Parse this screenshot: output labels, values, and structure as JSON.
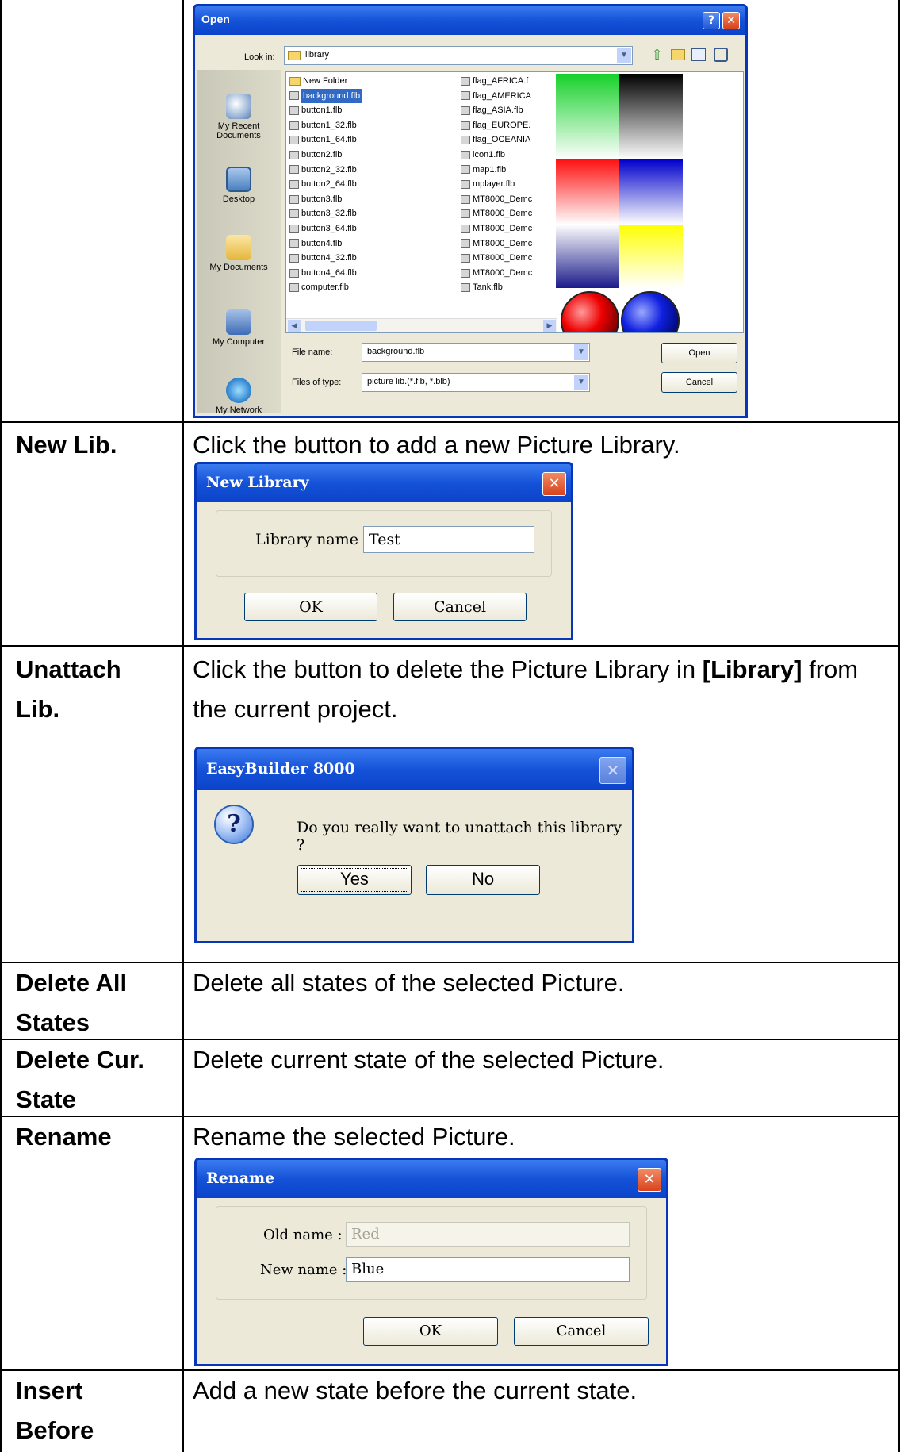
{
  "open_dialog": {
    "title": "Open",
    "look_in_label": "Look in:",
    "look_in_value": "library",
    "places": [
      "My Recent Documents",
      "Desktop",
      "My Documents",
      "My Computer",
      "My Network"
    ],
    "files_col1": [
      "New Folder",
      "background.flb",
      "button1.flb",
      "button1_32.flb",
      "button1_64.flb",
      "button2.flb",
      "button2_32.flb",
      "button2_64.flb",
      "button3.flb",
      "button3_32.flb",
      "button3_64.flb",
      "button4.flb",
      "button4_32.flb",
      "button4_64.flb",
      "computer.flb"
    ],
    "files_col2": [
      "flag_AFRICA.f",
      "flag_AMERICA",
      "flag_ASIA.flb",
      "flag_EUROPE.",
      "flag_OCEANIA",
      "icon1.flb",
      "map1.flb",
      "mplayer.flb",
      "MT8000_Demc",
      "MT8000_Demc",
      "MT8000_Demc",
      "MT8000_Demc",
      "MT8000_Demc",
      "MT8000_Demc",
      "Tank.flb"
    ],
    "file_name_label": "File name:",
    "file_name_value": "background.flb",
    "file_type_label": "Files of type:",
    "file_type_value": "picture lib.(*.flb, *.blb)",
    "open_button": "Open",
    "cancel_button": "Cancel",
    "help_button": "?",
    "close_button": "✕"
  },
  "rows": [
    {
      "label": "New Lib.",
      "text": "Click the button to add a new Picture Library."
    },
    {
      "label_line1": "Unattach",
      "label_line2": "Lib.",
      "text_before": "Click the button to delete the Picture Library in ",
      "text_bold": "[Library]",
      "text_after": " from",
      "text_line2": "the current project."
    },
    {
      "label_line1": "Delete All",
      "label_line2": "States",
      "text": "Delete all states of the selected Picture."
    },
    {
      "label_line1": "Delete Cur.",
      "label_line2": "State",
      "text": "Delete current state of the selected Picture."
    },
    {
      "label": "Rename",
      "text": "Rename the selected Picture."
    },
    {
      "label_line1": "Insert",
      "label_line2": "Before",
      "text": "Add a new state before the current state."
    }
  ],
  "new_library_dialog": {
    "title": "New Library",
    "name_label": "Library name :",
    "name_value": "Test",
    "ok": "OK",
    "cancel": "Cancel",
    "close": "✕"
  },
  "unattach_dialog": {
    "title": "EasyBuilder 8000",
    "icon": "?",
    "message": "Do you really want to unattach this library ?",
    "yes": "Yes",
    "no": "No",
    "close": "✕"
  },
  "rename_dialog": {
    "title": "Rename",
    "old_label": "Old name :",
    "old_value": "Red",
    "new_label": "New name :",
    "new_value": "Blue",
    "ok": "OK",
    "cancel": "Cancel",
    "close": "✕"
  }
}
